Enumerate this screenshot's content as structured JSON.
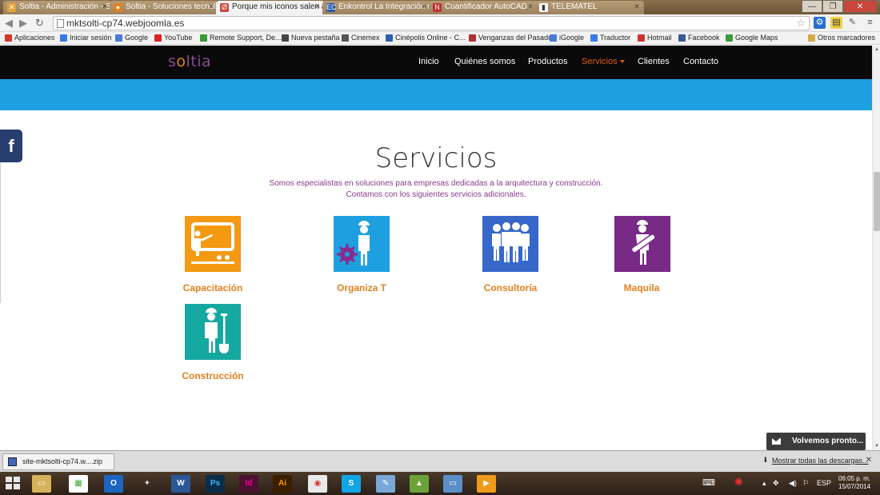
{
  "browser": {
    "tabs": [
      {
        "title": "Soltia - Administración - S",
        "active": false,
        "favicon_color": "#e8a43a",
        "favicon": "✕"
      },
      {
        "title": "Soltia - Soluciones tecnol",
        "active": false,
        "favicon_color": "#e0801d",
        "favicon": "●"
      },
      {
        "title": "Porque mis iconos salen a",
        "active": true,
        "favicon_color": "#c9463d",
        "favicon": "Ø"
      },
      {
        "title": "Enkontrol La Integración d",
        "active": false,
        "favicon_color": "#2a5aa8",
        "favicon": "EC"
      },
      {
        "title": "Cuantificador AutoCAD - ",
        "active": false,
        "favicon_color": "#c03030",
        "favicon": "N"
      },
      {
        "title": "TELEMATEL",
        "active": false,
        "favicon_color": "#ffffff",
        "favicon": "▮"
      }
    ],
    "url": "mktsolti-cp74.webjoomla.es",
    "bookmarks": [
      {
        "label": "Aplicaciones",
        "color": "#d2372b"
      },
      {
        "label": "Iniciar sesión",
        "color": "#3b78e7"
      },
      {
        "label": "Google",
        "color": "#4a7bd8"
      },
      {
        "label": "YouTube",
        "color": "#d22"
      },
      {
        "label": "Remote Support, De...",
        "color": "#3a9a3a"
      },
      {
        "label": "Nueva pestaña",
        "color": "#444"
      },
      {
        "label": "Cinemex",
        "color": "#555"
      },
      {
        "label": "Cinépolis Online - C...",
        "color": "#2a60b0"
      },
      {
        "label": "Venganzas del Pasado",
        "color": "#a33"
      },
      {
        "label": "iGoogle",
        "color": "#4a7bd8"
      },
      {
        "label": "Traductor",
        "color": "#3b78e7"
      },
      {
        "label": "Hotmail",
        "color": "#c33"
      },
      {
        "label": "Facebook",
        "color": "#3b5998"
      },
      {
        "label": "Google Maps",
        "color": "#3a9a3a"
      }
    ],
    "other_bookmarks": "Otros marcadores"
  },
  "site": {
    "logo_so": "s",
    "logo_o": "o",
    "logo_rest": "ltia",
    "menu": [
      {
        "label": "Inicio",
        "active": false
      },
      {
        "label": "Quiénes somos",
        "active": false
      },
      {
        "label": "Productos",
        "active": false
      },
      {
        "label": "Servicios",
        "active": true
      },
      {
        "label": "Clientes",
        "active": false
      },
      {
        "label": "Contacto",
        "active": false
      }
    ],
    "facebook_glyph": "f",
    "section_title": "Servicios",
    "subtitle_line1": "Somos especialistas en soluciones para empresas dedicadas a la arquitectura y construcción.",
    "subtitle_line2": "Contamos con los siguientes servicios adicionales.",
    "services": [
      {
        "label": "Capacitación",
        "color": "#f39a12",
        "icon": "teacher-icon"
      },
      {
        "label": "Organiza T",
        "color": "#1ea0e0",
        "icon": "worker-gear-icon"
      },
      {
        "label": "Consultoría",
        "color": "#3667c9",
        "icon": "team-icon"
      },
      {
        "label": "Maquila",
        "color": "#772a86",
        "icon": "drafter-icon"
      },
      {
        "label": "Construcción",
        "color": "#15a8a0",
        "icon": "builder-shovel-icon"
      }
    ],
    "chat_label": "Volvemos pronto..."
  },
  "downloads": {
    "file": "site-mktsolti-cp74.w....zip",
    "show_all": "Mostrar todas las descargas..."
  },
  "taskbar": {
    "lang": "ESP",
    "time": "06:05 p. m.",
    "date": "15/07/2014"
  }
}
